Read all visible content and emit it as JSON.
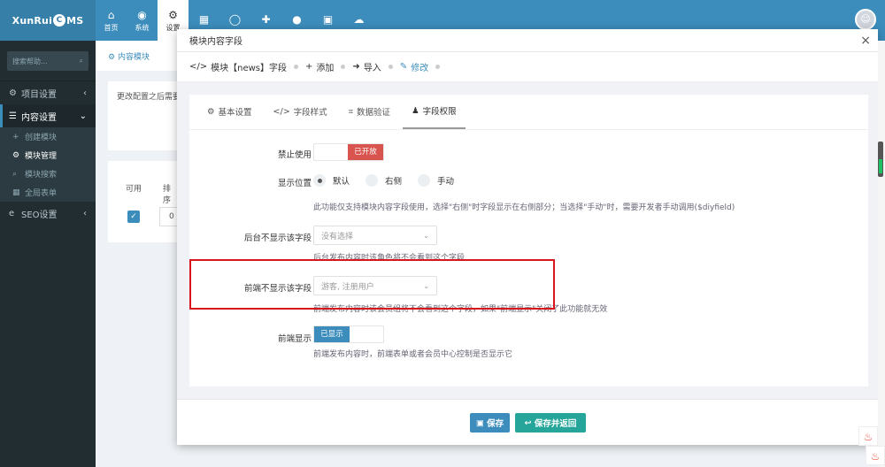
{
  "app": {
    "logo_pre": "XunRui",
    "logo_mid": "C",
    "logo_post": "MS"
  },
  "topnav": [
    {
      "icon": "home-icon",
      "glyph": "⌂",
      "label": "首页"
    },
    {
      "icon": "dashboard-icon",
      "glyph": "◉",
      "label": "系统"
    },
    {
      "icon": "gears-icon",
      "glyph": "⚙",
      "label": "设置"
    },
    {
      "icon": "grid-icon",
      "glyph": "▦",
      "label": ""
    },
    {
      "icon": "user-circle-icon",
      "glyph": "◯",
      "label": ""
    },
    {
      "icon": "puzzle-icon",
      "glyph": "✚",
      "label": ""
    },
    {
      "icon": "user-icon",
      "glyph": "●",
      "label": ""
    },
    {
      "icon": "html5-icon",
      "glyph": "▣",
      "label": ""
    },
    {
      "icon": "cloud-icon",
      "glyph": "☁",
      "label": ""
    }
  ],
  "sidebar": {
    "search_placeholder": "搜索帮助...",
    "items": [
      {
        "icon": "cog-icon",
        "glyph": "⚙",
        "label": "项目设置",
        "arrow": "‹"
      },
      {
        "icon": "list-icon",
        "glyph": "☰",
        "label": "内容设置",
        "arrow": "⌄"
      }
    ],
    "sub": [
      {
        "icon": "plus-icon",
        "glyph": "+",
        "label": "创建模块"
      },
      {
        "icon": "cogs-icon",
        "glyph": "⚙",
        "label": "模块管理"
      },
      {
        "icon": "search-icon",
        "glyph": "⌕",
        "label": "模块搜索"
      },
      {
        "icon": "table-icon",
        "glyph": "▦",
        "label": "全局表单"
      }
    ],
    "seo": {
      "icon": "internet-explorer-icon",
      "glyph": "e",
      "label": "SEO设置",
      "arrow": "‹"
    }
  },
  "background": {
    "tab": "内容模块",
    "note": "更改配置之后需要",
    "col_enabled": "可用",
    "col_order": "排序",
    "order_value": "0"
  },
  "modal": {
    "title": "模块内容字段",
    "close": "×",
    "breadcrumb": [
      {
        "icon": "code-icon",
        "glyph": "</>",
        "label": "模块【news】字段"
      },
      {
        "icon": "plus-icon",
        "glyph": "+",
        "label": "添加"
      },
      {
        "icon": "sign-in-icon",
        "glyph": "➜",
        "label": "导入"
      },
      {
        "icon": "edit-icon",
        "glyph": "✎",
        "label": "修改"
      }
    ],
    "tabs": [
      {
        "icon": "cog-icon",
        "glyph": "⚙",
        "label": "基本设置"
      },
      {
        "icon": "code-icon",
        "glyph": "</>",
        "label": "字段样式"
      },
      {
        "icon": "crop-icon",
        "glyph": "⌗",
        "label": "数据验证"
      },
      {
        "icon": "user-icon",
        "glyph": "♟",
        "label": "字段权限"
      }
    ],
    "form": {
      "disable_label": "禁止使用",
      "disable_toggle": "已开放",
      "position_label": "显示位置",
      "position_options": [
        "默认",
        "右侧",
        "手动"
      ],
      "position_help": "此功能仅支持模块内容字段使用，选择\"右侧\"时字段显示在右侧部分；当选择\"手动\"时，需要开发者手动调用($diyfield)",
      "backend_label": "后台不显示该字段",
      "backend_value": "没有选择",
      "backend_help": "后台发布内容时该角色将不会看到这个字段",
      "frontend_label": "前端不显示该字段",
      "frontend_value": "游客, 注册用户",
      "frontend_help": "前端发布内容时该会员组将不会看到这个字段，如果\"前端显示\"关闭了此功能就无效",
      "show_label": "前端显示",
      "show_toggle": "已显示",
      "show_help": "前端发布内容时，前端表单或者会员中心控制是否显示它"
    },
    "buttons": {
      "save": "保存",
      "save_back": "保存并返回"
    }
  },
  "colors": {
    "primary": "#3c8dbc",
    "danger": "#d9534f",
    "teal": "#26a69a",
    "highlight": "#d9161c"
  }
}
